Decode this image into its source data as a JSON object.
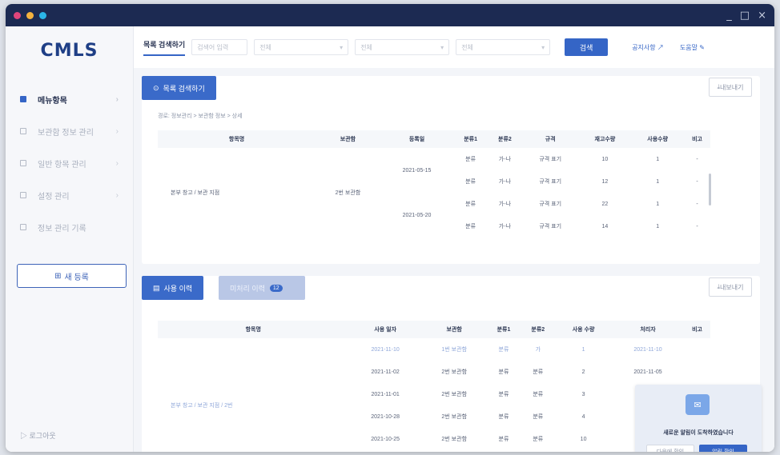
{
  "colors": {
    "titlebar": "#1c2a52",
    "dot_red": "#e0457b",
    "dot_yellow": "#f4b23e",
    "dot_cyan": "#2bb6e8",
    "accent": "#3565c6"
  },
  "window": {
    "controls": [
      "_",
      "□",
      "×"
    ]
  },
  "sidebar": {
    "logo": "CMLS",
    "items": [
      {
        "label": "메뉴항목",
        "icon": "dashboard-icon",
        "active": true
      },
      {
        "label": "보관함 정보 관리",
        "icon": "folder-icon",
        "active": false
      },
      {
        "label": "일반 항목 관리",
        "icon": "document-icon",
        "active": false
      },
      {
        "label": "설정 관리",
        "icon": "settings-icon",
        "active": false
      },
      {
        "label": "정보 관리 기록",
        "icon": "list-icon",
        "active": false
      }
    ],
    "new_button": "새 등록",
    "logout": "로그아웃"
  },
  "topbar": {
    "tab_label": "목록 검색하기",
    "search_placeholder": "검색어 입력",
    "select1": "전체",
    "select2": "전체",
    "select3": "전체",
    "search_button": "검색",
    "link1": "공지사항",
    "link2": "도움말"
  },
  "card1": {
    "button": "목록 검색하기",
    "export": "내보내기",
    "path": "경로: 정보관리 > 보관함 정보 > 상세",
    "headers": [
      "항목명",
      "보관함",
      "등록일",
      "분류1",
      "분류2",
      "규격",
      "재고수량",
      "사용수량",
      "비고"
    ],
    "group_label_1": "2번 보관함",
    "group_label_2": "본부 창고 / 보관 지점",
    "rows": [
      [
        "",
        "",
        "2021-05-15",
        "분류",
        "가-나",
        "규격 표기",
        "10",
        "1",
        "-"
      ],
      [
        "",
        "",
        "",
        "분류",
        "가-나",
        "규격 표기",
        "12",
        "1",
        "-"
      ],
      [
        "",
        "",
        "2021-05-20",
        "분류",
        "가-나",
        "규격 표기",
        "22",
        "1",
        "-"
      ],
      [
        "",
        "",
        "",
        "분류",
        "가-나",
        "규격 표기",
        "14",
        "1",
        "-"
      ]
    ]
  },
  "card2": {
    "tab1": "사용 이력",
    "tab2": "미처리 이력",
    "tab2_badge": "12",
    "export": "내보내기",
    "headers": [
      "항목명",
      "사용 일자",
      "보관함",
      "분류1",
      "분류2",
      "사용 수량",
      "처리자",
      "비고"
    ],
    "group_label": "본부 창고 / 보관 지점 / 2번",
    "rows": [
      [
        "",
        "2021-11-10",
        "1번 보관함",
        "분류",
        "가",
        "1",
        "2021-11-10",
        ""
      ],
      [
        "",
        "2021-11-02",
        "2번 보관함",
        "분류",
        "분류",
        "2",
        "2021-11-05",
        ""
      ],
      [
        "",
        "2021-11-01",
        "2번 보관함",
        "분류",
        "분류",
        "3",
        "",
        ""
      ],
      [
        "",
        "2021-10-28",
        "2번 보관함",
        "분류",
        "분류",
        "4",
        "",
        ""
      ],
      [
        "",
        "2021-10-25",
        "2번 보관함",
        "분류",
        "분류",
        "10",
        "",
        ""
      ],
      [
        "",
        "2021-10-20",
        "2번 보관함",
        "분류",
        "분류",
        "12",
        "",
        ""
      ]
    ]
  },
  "toast": {
    "message": "새로운 알림이 도착하였습니다",
    "cancel": "다음에 확인",
    "confirm": "알림 확인"
  }
}
